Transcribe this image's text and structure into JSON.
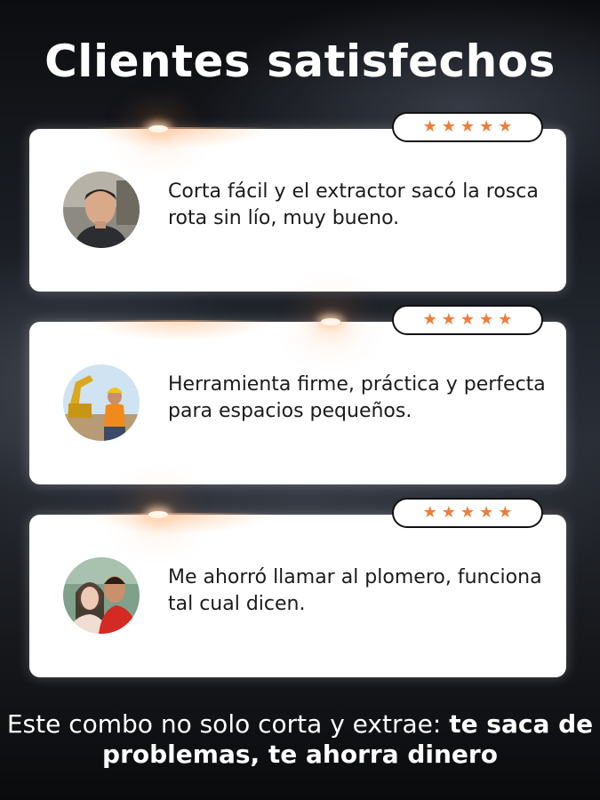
{
  "header": {
    "title": "Clientes satisfechos"
  },
  "colors": {
    "star": "#ef7d3a",
    "card": "#ffffff",
    "text": "#1b1b1b"
  },
  "reviews": [
    {
      "rating": 5,
      "avatar_icon": "man-portrait-avatar",
      "text": "Corta fácil y el extractor sacó la rosca rota sin lío, muy bueno."
    },
    {
      "rating": 5,
      "avatar_icon": "worker-excavator-avatar",
      "text": "Herramienta firme, práctica y perfecta para espacios pequeños."
    },
    {
      "rating": 5,
      "avatar_icon": "couple-portrait-avatar",
      "text": "Me ahorró llamar al plomero, funciona tal cual dicen."
    }
  ],
  "footer": {
    "text_regular": "Este combo no solo corta y extrae: ",
    "text_bold": "te saca de problemas, te ahorra dinero"
  }
}
